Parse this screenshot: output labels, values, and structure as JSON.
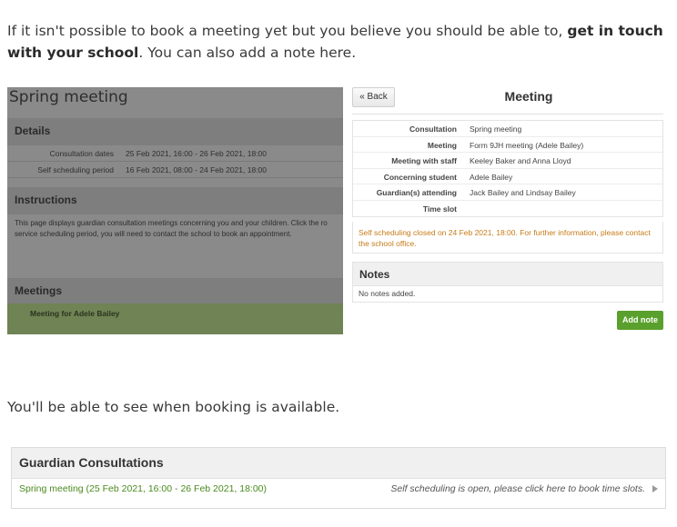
{
  "intro": {
    "text_before": "If it isn't possible to book a meeting yet but you believe you should be able to, ",
    "bold": "get in touch with your school",
    "text_after": ". You can also add a note here."
  },
  "left_panel": {
    "title": "Spring meeting",
    "details_heading": "Details",
    "details": [
      {
        "label": "Consultation dates",
        "value": "25 Feb 2021, 16:00 - 26 Feb 2021, 18:00"
      },
      {
        "label": "Self scheduling period",
        "value": "16 Feb 2021, 08:00 - 24 Feb 2021, 18:00"
      }
    ],
    "instructions_heading": "Instructions",
    "instructions_line1": "This page displays guardian consultation meetings concerning you and your children. Click the ro",
    "instructions_line2": "service scheduling period, you will need to contact the school to book an appointment.",
    "meetings_heading": "Meetings",
    "meeting_item": "Meeting for Adele Bailey"
  },
  "dialog": {
    "back_label": "« Back",
    "title": "Meeting",
    "rows": [
      {
        "label": "Consultation",
        "value": "Spring meeting"
      },
      {
        "label": "Meeting",
        "value": "Form 9JH meeting (Adele Bailey)"
      },
      {
        "label": "Meeting with staff",
        "value": "Keeley Baker and Anna Lloyd"
      },
      {
        "label": "Concerning student",
        "value": "Adele Bailey"
      },
      {
        "label": "Guardian(s) attending",
        "value": "Jack Bailey and Lindsay Bailey"
      },
      {
        "label": "Time slot",
        "value": ""
      }
    ],
    "warning": "Self scheduling closed on 24 Feb 2021, 18:00. For further information, please contact the school office.",
    "notes_heading": "Notes",
    "notes_empty": "No notes added.",
    "add_note_label": "Add note"
  },
  "mid_text": "You'll be able to see when booking is available.",
  "guardian_consultations": {
    "heading": "Guardian Consultations",
    "link": "Spring meeting (25 Feb 2021, 16:00 - 26 Feb 2021, 18:00)",
    "status": "Self scheduling is open, please click here to book time slots."
  },
  "colors": {
    "accent_green": "#5aa02c",
    "link_green": "#4a8a1e",
    "warning_orange": "#c77b17"
  }
}
